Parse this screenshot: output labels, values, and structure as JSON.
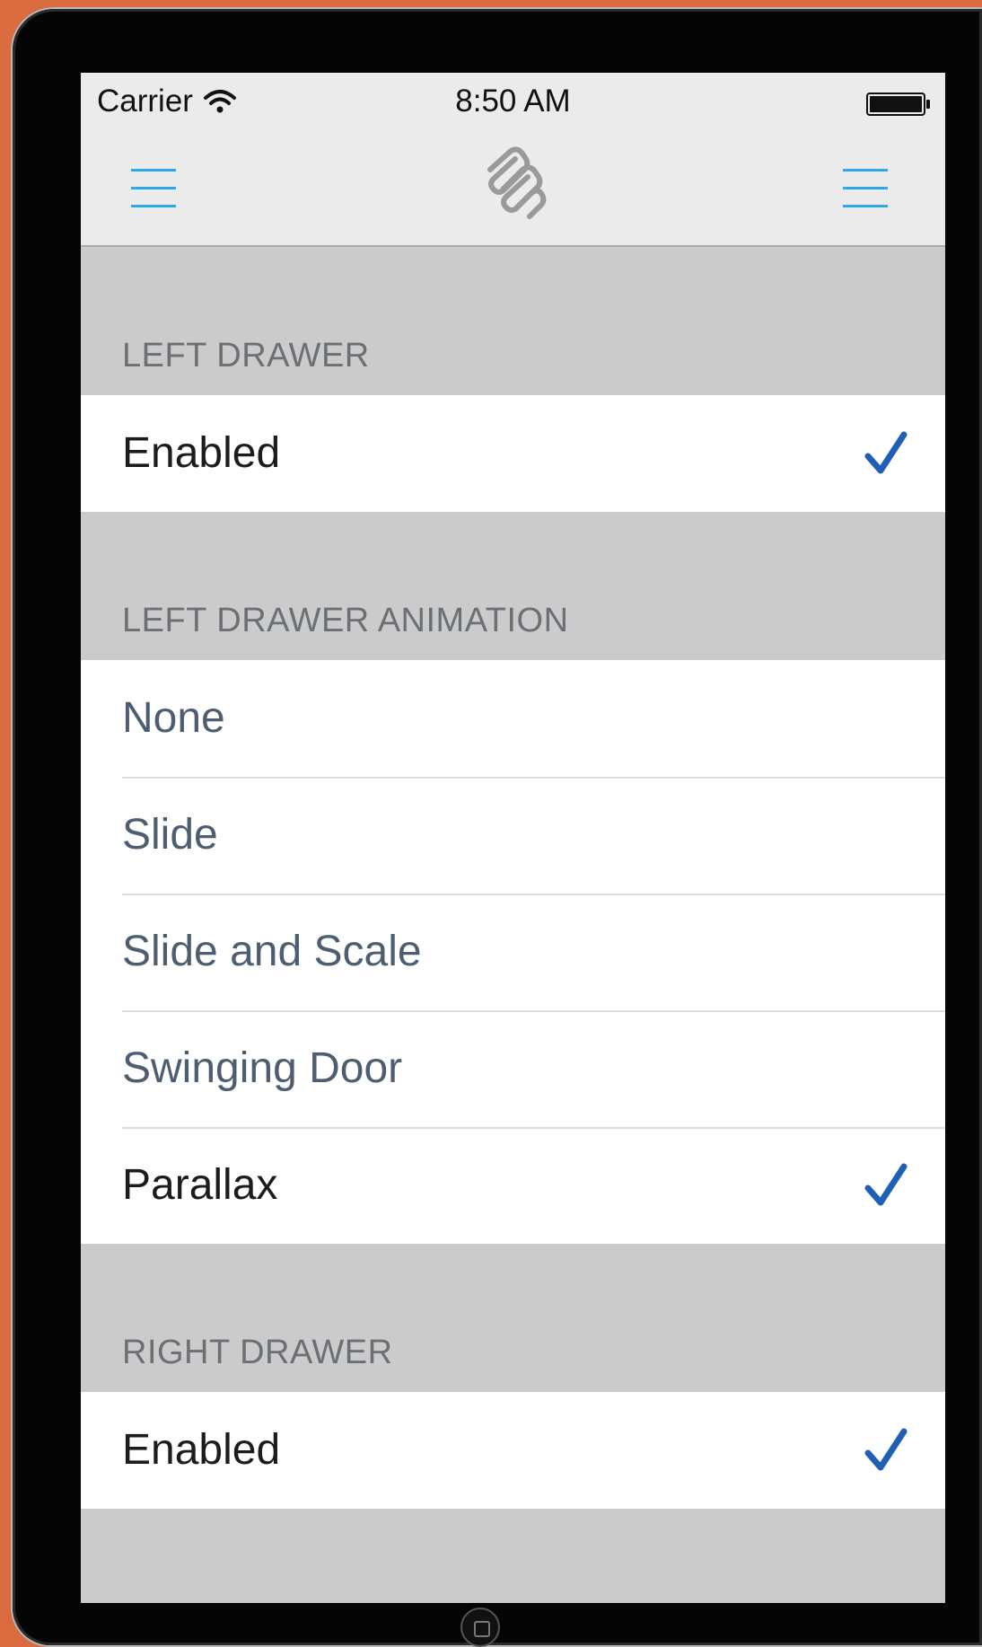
{
  "status_bar": {
    "carrier": "Carrier",
    "time": "8:50 AM"
  },
  "nav_bar": {
    "left_button_icon": "hamburger-menu-icon",
    "right_button_icon": "hamburger-menu-icon",
    "logo_icon": "paperclip-logo-icon",
    "accent_color": "#2aa9e6"
  },
  "sections": {
    "left_drawer": {
      "title": "LEFT DRAWER",
      "rows": [
        {
          "label": "Enabled",
          "checked": true
        }
      ]
    },
    "left_drawer_animation": {
      "title": "LEFT DRAWER ANIMATION",
      "rows": [
        {
          "label": "None",
          "checked": false
        },
        {
          "label": "Slide",
          "checked": false
        },
        {
          "label": "Slide and Scale",
          "checked": false
        },
        {
          "label": "Swinging Door",
          "checked": false
        },
        {
          "label": "Parallax",
          "checked": true
        }
      ]
    },
    "right_drawer": {
      "title": "RIGHT DRAWER",
      "rows": [
        {
          "label": "Enabled",
          "checked": true
        }
      ]
    }
  },
  "colors": {
    "check": "#1f5fb5",
    "background": "#cbcbcb"
  }
}
